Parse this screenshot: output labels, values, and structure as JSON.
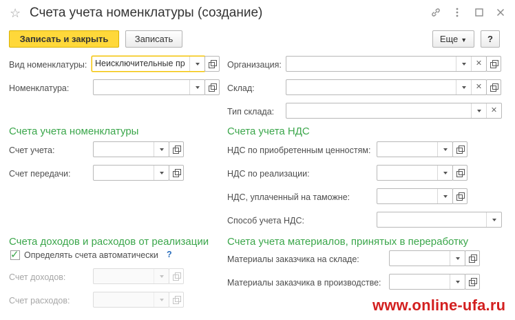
{
  "window": {
    "title": "Счета учета номенклатуры (создание)"
  },
  "toolbar": {
    "save_close_label": "Записать и закрыть",
    "save_label": "Записать",
    "more_label": "Еще",
    "help_label": "?"
  },
  "fields": {
    "vid_nomenklatury": {
      "label": "Вид номенклатуры:",
      "value": "Неисключительные пр"
    },
    "nomenklatura": {
      "label": "Номенклатура:",
      "value": ""
    },
    "organizaciya": {
      "label": "Организация:",
      "value": ""
    },
    "sklad": {
      "label": "Склад:",
      "value": ""
    },
    "tip_sklada": {
      "label": "Тип склада:",
      "value": ""
    }
  },
  "sections": {
    "accounts": {
      "title": "Счета учета номенклатуры",
      "schet_ucheta": {
        "label": "Счет учета:",
        "value": ""
      },
      "schet_peredachi": {
        "label": "Счет передачи:",
        "value": ""
      }
    },
    "vat": {
      "title": "Счета учета НДС",
      "nds_priobr": {
        "label": "НДС по приобретенным ценностям:",
        "value": ""
      },
      "nds_realiz": {
        "label": "НДС по реализации:",
        "value": ""
      },
      "nds_tamozh": {
        "label": "НДС, уплаченный на таможне:",
        "value": ""
      },
      "sposob_nds": {
        "label": "Способ учета НДС:",
        "value": ""
      }
    },
    "income": {
      "title": "Счета доходов и расходов от реализации",
      "auto_checkbox_label": "Определять счета автоматически",
      "auto_checked": true,
      "help_mark": "?",
      "schet_dohodov": {
        "label": "Счет доходов:",
        "value": ""
      },
      "schet_rashodov": {
        "label": "Счет расходов:",
        "value": ""
      }
    },
    "materials": {
      "title": "Счета учета материалов, принятых в переработку",
      "na_sklade": {
        "label": "Материалы заказчика на складе:",
        "value": ""
      },
      "v_proizvodstve": {
        "label": "Материалы заказчика в производстве:",
        "value": ""
      }
    }
  },
  "watermark": "www.online-ufa.ru",
  "colors": {
    "primary_button": "#ffd83a",
    "section_title": "#3aa64a",
    "focus_border": "#f2c200",
    "watermark": "#d32020"
  }
}
